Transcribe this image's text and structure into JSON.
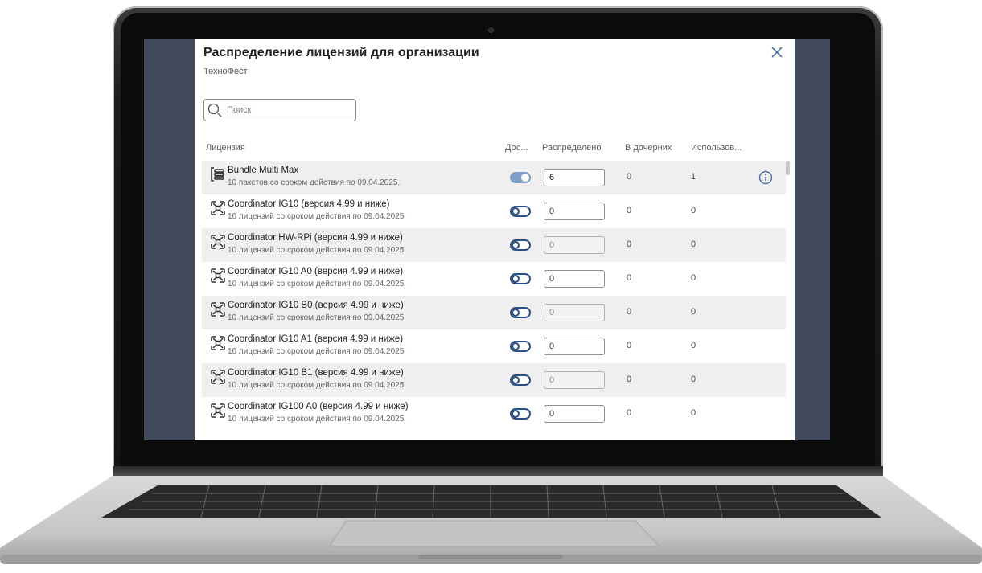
{
  "dialog": {
    "title": "Распределение лицензий для организации",
    "subtitle": "ТехноФест",
    "close_icon": "close-icon"
  },
  "search": {
    "placeholder": "Поиск",
    "value": ""
  },
  "columns": {
    "license": "Лицензия",
    "access": "Дос...",
    "distributed": "Распределено",
    "children": "В дочерних",
    "used": "Использов..."
  },
  "rows": [
    {
      "icon": "bundle-icon",
      "name": "Bundle Multi Max",
      "desc": "10 пакетов со сроком действия по 09.04.2025.",
      "enabled": true,
      "distributed": "6",
      "children": "0",
      "used": "1",
      "info": true
    },
    {
      "icon": "coordinator-icon",
      "name": "Coordinator IG10 (версия 4.99 и ниже)",
      "desc": "10 лицензий со сроком действия по 09.04.2025.",
      "enabled": false,
      "distributed": "0",
      "children": "0",
      "used": "0"
    },
    {
      "icon": "coordinator-icon",
      "name": "Coordinator HW-RPi (версия 4.99 и ниже)",
      "desc": "10 лицензий со сроком действия по 09.04.2025.",
      "enabled": false,
      "distributed": "0",
      "children": "0",
      "used": "0"
    },
    {
      "icon": "coordinator-icon",
      "name": "Coordinator IG10 A0 (версия 4.99 и ниже)",
      "desc": "10 лицензий со сроком действия по 09.04.2025.",
      "enabled": false,
      "distributed": "0",
      "children": "0",
      "used": "0"
    },
    {
      "icon": "coordinator-icon",
      "name": "Coordinator IG10 B0 (версия 4.99 и ниже)",
      "desc": "10 лицензий со сроком действия по 09.04.2025.",
      "enabled": false,
      "distributed": "0",
      "children": "0",
      "used": "0"
    },
    {
      "icon": "coordinator-icon",
      "name": "Coordinator IG10 A1 (версия 4.99 и ниже)",
      "desc": "10 лицензий со сроком действия по 09.04.2025.",
      "enabled": false,
      "distributed": "0",
      "children": "0",
      "used": "0"
    },
    {
      "icon": "coordinator-icon",
      "name": "Coordinator IG10 B1 (версия 4.99 и ниже)",
      "desc": "10 лицензий со сроком действия по 09.04.2025.",
      "enabled": false,
      "distributed": "0",
      "children": "0",
      "used": "0"
    },
    {
      "icon": "coordinator-icon",
      "name": "Coordinator IG100 A0 (версия 4.99 и ниже)",
      "desc": "10 лицензий со сроком действия по 09.04.2025.",
      "enabled": false,
      "distributed": "0",
      "children": "0",
      "used": "0"
    }
  ],
  "colors": {
    "accent": "#2b4f86",
    "toggle_on": "#7d9fc9",
    "row_alt": "#efefef",
    "backdrop": "#414b5c"
  }
}
